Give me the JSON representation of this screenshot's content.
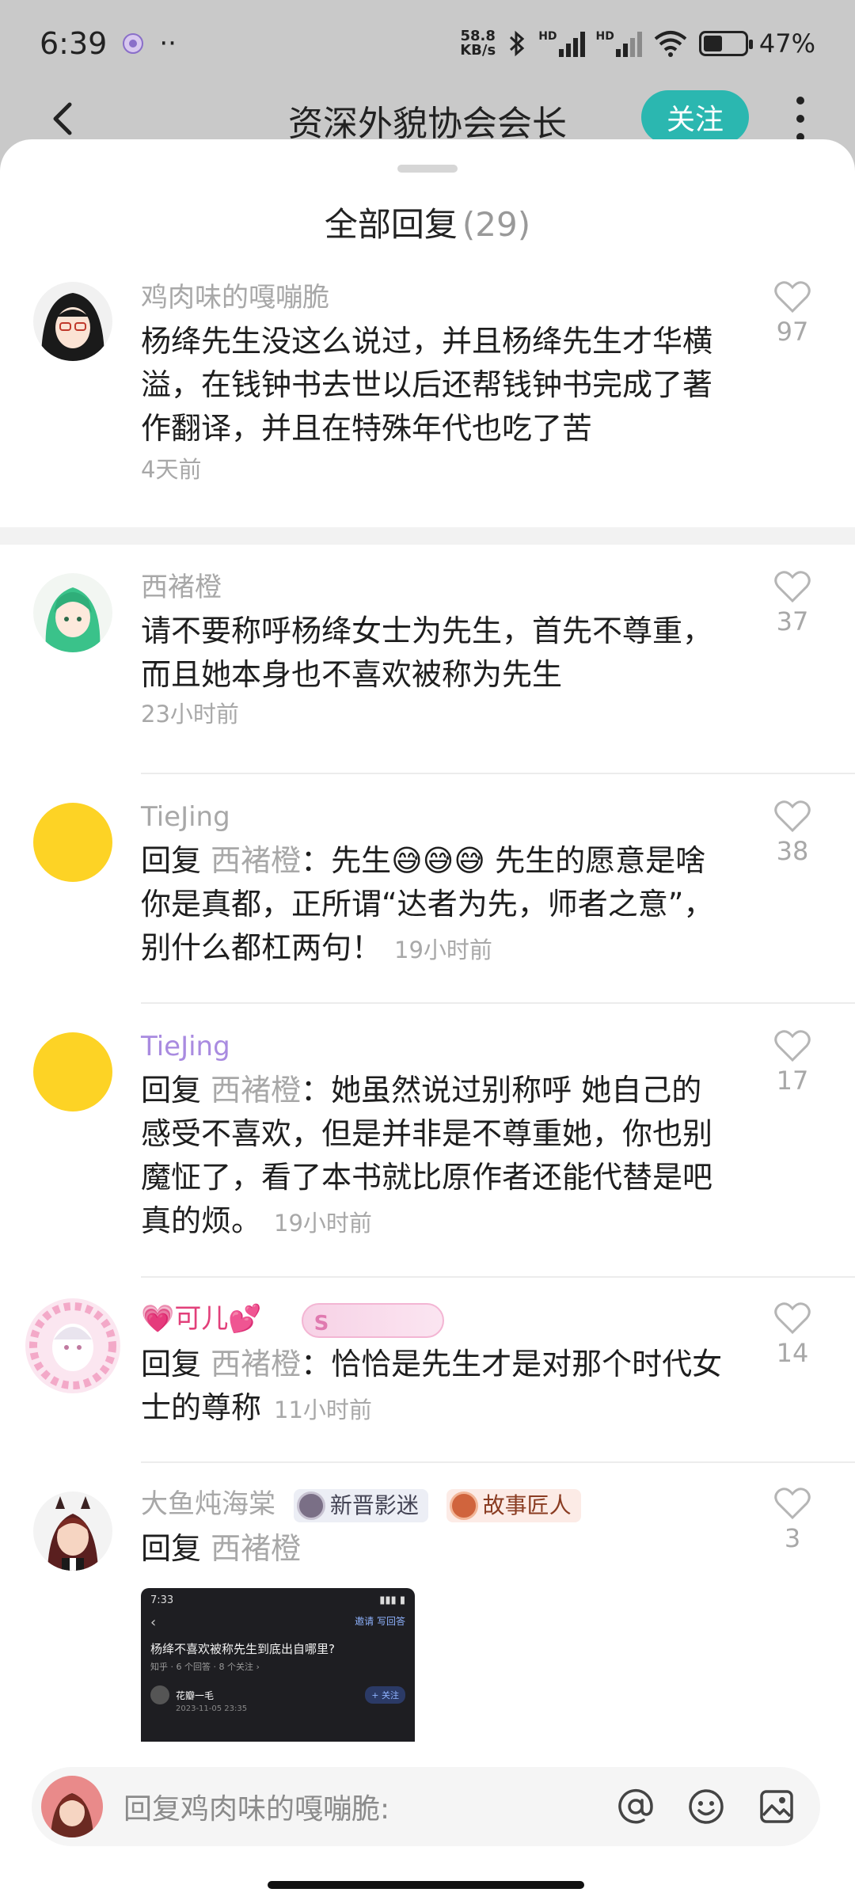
{
  "status": {
    "time": "6:39",
    "dots": "··",
    "net_speed_value": "58.8",
    "net_speed_unit": "KB/s",
    "hd1": "HD",
    "hd2": "HD",
    "battery_text": "47%",
    "battery_level": 0.47
  },
  "header": {
    "title": "资深外貌协会会长",
    "follow_label": "关注"
  },
  "sheet": {
    "title": "全部回复",
    "count": "(29)"
  },
  "comments": [
    {
      "name": "鸡肉味的嘎嘣脆",
      "text": "杨绛先生没这么说过，并且杨绛先生才华横溢，在钱钟书去世以后还帮钱钟书完成了著作翻译，并且在特殊年代也吃了苦",
      "time": "4天前",
      "likes": "97"
    },
    {
      "name": "西褚橙",
      "text": "请不要称呼杨绛女士为先生，首先不尊重，而且她本身也不喜欢被称为先生",
      "time": "23小时前",
      "likes": "37"
    },
    {
      "name": "TieJing",
      "reply_prefix": "回复",
      "reply_to": "西褚橙",
      "text_a": "：先生",
      "emoji": "😅😅😅",
      "text_b": "  先生的愿意是啥 你是真都，正所谓“达者为先，师者之意”，别什么都杠两句！",
      "time": "19小时前",
      "likes": "38"
    },
    {
      "name": "TieJing",
      "reply_prefix": "回复",
      "reply_to": "西褚橙",
      "text": "：她虽然说过别称呼 她自己的感受不喜欢，但是并非是不尊重她，你也别魔怔了，看了本书就比原作者还能代替是吧 真的烦。",
      "time": "19小时前",
      "likes": "17"
    },
    {
      "name": "💗可儿💕",
      "reply_prefix": "回复",
      "reply_to": "西褚橙",
      "text": "：恰恰是先生才是对那个时代女士的尊称",
      "time": "11小时前",
      "likes": "14"
    },
    {
      "name": "大鱼炖海棠",
      "badge1": "新晋影迷",
      "badge2": "故事匠人",
      "reply_prefix": "回复",
      "reply_to": "西褚橙",
      "likes": "3"
    }
  ],
  "thumbnail": {
    "time": "7:33",
    "invite": "邀请",
    "write": "写回答",
    "question": "杨绛不喜欢被称先生到底出自哪里?",
    "meta": "知乎 · 6 个回答 · 8 个关注 ›",
    "user": "花瓣一毛",
    "follow": "+ 关注",
    "date": "2023-11-05 23:35"
  },
  "input": {
    "placeholder": "回复鸡肉味的嘎嘣脆:"
  },
  "colors": {
    "accent": "#2bb7b0",
    "name_gray": "#a8a8a8",
    "name_purple": "#a98be0"
  },
  "icons": [
    "back-icon",
    "more-icon",
    "heart-icon",
    "at-icon",
    "emoji-icon",
    "image-icon",
    "bluetooth-icon",
    "wifi-icon",
    "battery-icon"
  ]
}
